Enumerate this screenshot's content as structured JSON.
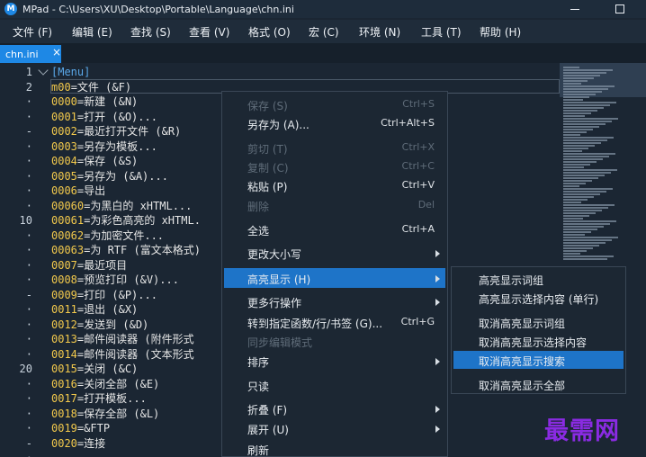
{
  "window": {
    "app_icon_letter": "M",
    "title": "MPad - C:\\Users\\XU\\Desktop\\Portable\\Language\\chn.ini"
  },
  "menubar": [
    {
      "label": "文件 (F)"
    },
    {
      "label": "编辑 (E)"
    },
    {
      "label": "查找 (S)"
    },
    {
      "label": "查看 (V)"
    },
    {
      "label": "格式 (O)"
    },
    {
      "label": "宏 (C)"
    },
    {
      "label": "环境 (N)"
    },
    {
      "label": "工具 (T)"
    },
    {
      "label": "帮助 (H)"
    }
  ],
  "tabs": [
    {
      "label": "chn.ini",
      "close": "×"
    }
  ],
  "gutter": {
    "line_numbers": [
      "1",
      "2",
      "·",
      "·",
      "-",
      "·",
      "·",
      "·",
      "·",
      "·",
      "10",
      "·",
      "·",
      "·",
      "·",
      "-",
      "·",
      "·",
      "·",
      "·",
      "20",
      "·",
      "·",
      "·",
      "·",
      "-",
      "·"
    ]
  },
  "editor": {
    "lines": [
      {
        "key": "",
        "sep": "",
        "val": "[Menu]",
        "bracket": true
      },
      {
        "key": "m00",
        "sep": "=",
        "val": "文件 (&F)"
      },
      {
        "key": "0000",
        "sep": "=",
        "val": "新建 (&N)"
      },
      {
        "key": "0001",
        "sep": "=",
        "val": "打开 (&O)..."
      },
      {
        "key": "0002",
        "sep": "=",
        "val": "最近打开文件 (&R)"
      },
      {
        "key": "0003",
        "sep": "=",
        "val": "另存为模板..."
      },
      {
        "key": "0004",
        "sep": "=",
        "val": "保存 (&S)"
      },
      {
        "key": "0005",
        "sep": "=",
        "val": "另存为 (&A)..."
      },
      {
        "key": "0006",
        "sep": "=",
        "val": "导出"
      },
      {
        "key": "00060",
        "sep": "=",
        "val": "为黑白的 xHTML..."
      },
      {
        "key": "00061",
        "sep": "=",
        "val": "为彩色高亮的 xHTML."
      },
      {
        "key": "00062",
        "sep": "=",
        "val": "为加密文件..."
      },
      {
        "key": "00063",
        "sep": "=",
        "val": "为 RTF (富文本格式)"
      },
      {
        "key": "0007",
        "sep": "=",
        "val": "最近项目"
      },
      {
        "key": "0008",
        "sep": "=",
        "val": "预览打印 (&V)..."
      },
      {
        "key": "0009",
        "sep": "=",
        "val": "打印 (&P)..."
      },
      {
        "key": "0011",
        "sep": "=",
        "val": "退出 (&X)"
      },
      {
        "key": "0012",
        "sep": "=",
        "val": "发送到 (&D)"
      },
      {
        "key": "0013",
        "sep": "=",
        "val": "邮件阅读器 (附件形式"
      },
      {
        "key": "0014",
        "sep": "=",
        "val": "邮件阅读器 (文本形式"
      },
      {
        "key": "0015",
        "sep": "=",
        "val": "关闭 (&C)"
      },
      {
        "key": "0016",
        "sep": "=",
        "val": "关闭全部 (&E)"
      },
      {
        "key": "0017",
        "sep": "=",
        "val": "打开模板..."
      },
      {
        "key": "0018",
        "sep": "=",
        "val": "保存全部 (&L)"
      },
      {
        "key": "0019",
        "sep": "=",
        "val": "&FTP"
      },
      {
        "key": "0020",
        "sep": "=",
        "val": "连接"
      }
    ]
  },
  "context_menu": {
    "items": [
      {
        "label": "保存 (S)",
        "shortcut": "Ctrl+S",
        "enabled": false
      },
      {
        "label": "另存为 (A)...",
        "shortcut": "Ctrl+Alt+S",
        "enabled": true
      },
      {
        "label": "剪切 (T)",
        "shortcut": "Ctrl+X",
        "enabled": false
      },
      {
        "label": "复制 (C)",
        "shortcut": "Ctrl+C",
        "enabled": false
      },
      {
        "label": "粘贴 (P)",
        "shortcut": "Ctrl+V",
        "enabled": true
      },
      {
        "label": "删除",
        "shortcut": "Del",
        "enabled": false
      },
      {
        "label": "全选",
        "shortcut": "Ctrl+A",
        "enabled": true
      },
      {
        "label": "更改大小写",
        "shortcut": "",
        "enabled": true,
        "submenu": true
      },
      {
        "label": "高亮显示 (H)",
        "shortcut": "",
        "enabled": true,
        "submenu": true,
        "highlighted": true
      },
      {
        "label": "更多行操作",
        "shortcut": "",
        "enabled": true,
        "submenu": true
      },
      {
        "label": "转到指定函数/行/书签 (G)...",
        "shortcut": "Ctrl+G",
        "enabled": true
      },
      {
        "label": "同步编辑模式",
        "shortcut": "",
        "enabled": false
      },
      {
        "label": "排序",
        "shortcut": "",
        "enabled": true,
        "submenu": true
      },
      {
        "label": "只读",
        "shortcut": "",
        "enabled": true
      },
      {
        "label": "折叠 (F)",
        "shortcut": "",
        "enabled": true,
        "submenu": true
      },
      {
        "label": "展开 (U)",
        "shortcut": "",
        "enabled": true,
        "submenu": true
      },
      {
        "label": "刷新",
        "shortcut": "",
        "enabled": true
      }
    ]
  },
  "submenu": {
    "items": [
      {
        "label": "高亮显示词组"
      },
      {
        "label": "高亮显示选择内容 (单行)"
      },
      {
        "label": "取消高亮显示词组"
      },
      {
        "label": "取消高亮显示选择内容"
      },
      {
        "label": "取消高亮显示搜索",
        "highlighted": true
      },
      {
        "label": "取消高亮显示全部"
      }
    ]
  },
  "watermark": "最需网",
  "colors": {
    "accent": "#1e88e5",
    "menu_highlight": "#1e74c8",
    "editor_bg": "#1b2633",
    "key_yellow": "#f2c94c",
    "watermark_purple": "#8a2be2"
  }
}
